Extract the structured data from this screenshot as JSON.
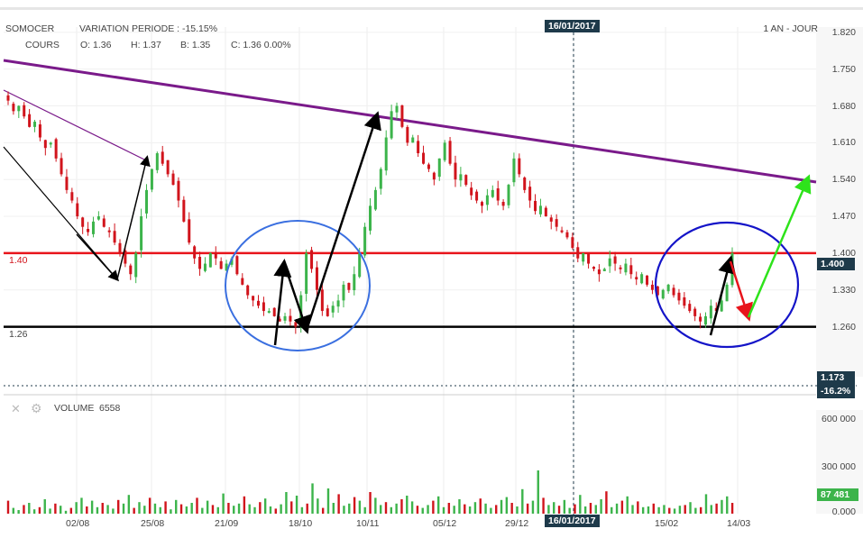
{
  "header": {
    "symbol": "SOMOCER",
    "variation_label": "VARIATION PERIODE : -15.15%",
    "series_label": "COURS",
    "open": "O: 1.36",
    "high": "H: 1.37",
    "low": "B: 1.35",
    "close": "C: 1.36 0.00%",
    "period": "1 AN - JOUR",
    "cursor_date_top": "16/01/2017"
  },
  "volume_panel": {
    "label": "VOLUME",
    "value": "6558",
    "last_value": "87 481",
    "yticks": [
      "600 000",
      "300 000",
      "0.000"
    ]
  },
  "tags": {
    "price": "1.400",
    "target": "1.173",
    "target_pct": "-16.2%",
    "cursor_date_bottom": "16/01/2017"
  },
  "levels": {
    "resistance_label": "1.40",
    "support_label": "1.26"
  },
  "colors": {
    "up": "#3cb44b",
    "down": "#d1141c",
    "trendline": "#7a1a8a",
    "resistance": "#e8141b",
    "support": "#000000",
    "circle_left": "#3a6fe0",
    "circle_right": "#1414c8",
    "tag_bg": "#1e3a4a"
  },
  "chart_data": {
    "type": "candlestick",
    "title": "SOMOCER",
    "timeframe": "1 AN - JOUR",
    "yticks": [
      1.82,
      1.75,
      1.68,
      1.61,
      1.54,
      1.47,
      1.4,
      1.33,
      1.26
    ],
    "ytick_labels": [
      "1.820",
      "1.750",
      "1.680",
      "1.610",
      "1.540",
      "1.470",
      "1.400",
      "1.330",
      "1.260"
    ],
    "xtick_labels": [
      "02/08",
      "25/08",
      "21/09",
      "18/10",
      "10/11",
      "05/12",
      "29/12",
      "16/01/2017",
      "15/02",
      "14/03"
    ],
    "ylim": [
      1.165,
      1.83
    ],
    "horizontal_lines": [
      1.4,
      1.26
    ],
    "closes": [
      1.69,
      1.67,
      1.68,
      1.66,
      1.64,
      1.65,
      1.62,
      1.6,
      1.61,
      1.58,
      1.55,
      1.52,
      1.5,
      1.47,
      1.45,
      1.44,
      1.46,
      1.47,
      1.45,
      1.44,
      1.42,
      1.4,
      1.38,
      1.36,
      1.4,
      1.47,
      1.52,
      1.56,
      1.59,
      1.57,
      1.55,
      1.53,
      1.5,
      1.46,
      1.42,
      1.39,
      1.37,
      1.38,
      1.4,
      1.39,
      1.37,
      1.38,
      1.39,
      1.36,
      1.34,
      1.32,
      1.31,
      1.3,
      1.29,
      1.29,
      1.28,
      1.27,
      1.28,
      1.27,
      1.26,
      1.32,
      1.4,
      1.37,
      1.33,
      1.29,
      1.28,
      1.3,
      1.31,
      1.34,
      1.33,
      1.36,
      1.4,
      1.45,
      1.49,
      1.52,
      1.56,
      1.62,
      1.67,
      1.68,
      1.64,
      1.61,
      1.62,
      1.59,
      1.57,
      1.56,
      1.54,
      1.58,
      1.61,
      1.57,
      1.54,
      1.55,
      1.53,
      1.51,
      1.5,
      1.49,
      1.51,
      1.52,
      1.5,
      1.49,
      1.53,
      1.58,
      1.55,
      1.52,
      1.5,
      1.48,
      1.49,
      1.47,
      1.46,
      1.45,
      1.44,
      1.43,
      1.41,
      1.39,
      1.4,
      1.38,
      1.37,
      1.36,
      1.37,
      1.39,
      1.38,
      1.37,
      1.38,
      1.36,
      1.35,
      1.36,
      1.34,
      1.33,
      1.32,
      1.33,
      1.34,
      1.32,
      1.31,
      1.3,
      1.29,
      1.28,
      1.27,
      1.28,
      1.3,
      1.29,
      1.31,
      1.34,
      1.4
    ],
    "volumes": [
      18,
      8,
      5,
      12,
      15,
      6,
      9,
      20,
      7,
      14,
      11,
      4,
      8,
      16,
      22,
      10,
      18,
      9,
      15,
      12,
      7,
      19,
      14,
      26,
      8,
      16,
      11,
      22,
      14,
      9,
      17,
      6,
      19,
      13,
      10,
      15,
      22,
      8,
      18,
      12,
      9,
      28,
      15,
      11,
      14,
      24,
      13,
      9,
      16,
      21,
      10,
      7,
      13,
      30,
      17,
      25,
      9,
      14,
      42,
      21,
      8,
      35,
      15,
      27,
      11,
      14,
      23,
      18,
      9,
      30,
      22,
      12,
      16,
      9,
      14,
      20,
      25,
      17,
      11,
      8,
      12,
      18,
      24,
      9,
      15,
      11,
      20,
      13,
      10,
      16,
      21,
      14,
      8,
      12,
      19,
      23,
      15,
      10,
      34,
      14,
      18,
      60,
      22,
      12,
      16,
      11,
      19,
      8,
      13,
      26,
      10,
      15,
      12,
      20,
      31,
      9,
      14,
      18,
      24,
      12,
      17,
      9,
      10,
      14,
      9,
      12,
      8,
      7,
      11,
      12,
      16,
      8,
      9,
      27,
      12,
      14,
      19,
      24,
      15
    ],
    "volume_ylim": [
      0,
      600000
    ]
  }
}
